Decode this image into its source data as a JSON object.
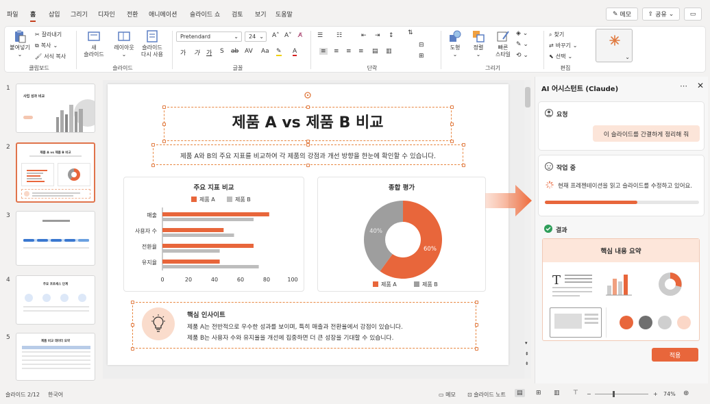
{
  "menu": {
    "items": [
      "파일",
      "홈",
      "삽입",
      "그리기",
      "디자인",
      "전환",
      "애니메이션",
      "슬라이드 쇼",
      "검토",
      "보기",
      "도움말"
    ],
    "active": "홈",
    "memo": "메모",
    "share": "공유"
  },
  "ribbon": {
    "clipboard": {
      "paste": "붙여넣기",
      "cut": "잘라내기",
      "copy": "복사",
      "format_painter": "서식 복사",
      "label": "클립보드"
    },
    "slides": {
      "new": "새\n슬라이드",
      "layout": "레이아웃",
      "reset": "슬라이드\n다시 사용",
      "label": "슬라이드"
    },
    "font": {
      "name": "Pretendard",
      "size": "24",
      "label": "글꼴"
    },
    "paragraph": {
      "label": "단락"
    },
    "drawing": {
      "shapes": "도형",
      "arrange": "정렬",
      "quick_styles": "빠른\n스타일",
      "label": "그리기"
    },
    "editing": {
      "find": "찾기",
      "replace": "바꾸기",
      "select": "선택",
      "label": "편집"
    }
  },
  "thumbnails": [
    {
      "num": "1",
      "title": "사업 성과 비교"
    },
    {
      "num": "2",
      "title": "제품 A vs 제품 B 비교"
    },
    {
      "num": "3",
      "title": ""
    },
    {
      "num": "4",
      "title": "주요 프로세스 단계"
    },
    {
      "num": "5",
      "title": "제품 비교 데이터 요약"
    }
  ],
  "slide": {
    "title": "제품 A vs 제품 B 비교",
    "subtitle": "제품 A와 B의 주요 지표를 비교하여 각 제품의 강점과 개선 방향을 한눈에 확인할 수 있습니다.",
    "bar_title": "주요 지표 비교",
    "donut_title": "종합 평가",
    "insight_title": "핵심 인사이트",
    "insight_line1": "제품 A는 전반적으로 우수한 성과를 보이며, 특히 매출과 전환율에서 강점이 있습니다.",
    "insight_line2": "제품 B는 사용자 수와 유지율을 개선에 집중하면 더 큰 성장을 기대할 수 있습니다."
  },
  "chart_data": [
    {
      "type": "bar",
      "orientation": "horizontal",
      "title": "주요 지표 비교",
      "categories": [
        "매출",
        "사용자 수",
        "전환율",
        "유지율"
      ],
      "series": [
        {
          "name": "제품 A",
          "values": [
            82,
            47,
            70,
            44
          ]
        },
        {
          "name": "제품 B",
          "values": [
            70,
            55,
            44,
            74
          ]
        }
      ],
      "xticks": [
        "0",
        "20",
        "40",
        "60",
        "80",
        "100"
      ],
      "xlim": [
        0,
        100
      ],
      "colors": {
        "제품 A": "#e8663b",
        "제품 B": "#bdbdbd"
      }
    },
    {
      "type": "pie",
      "title": "종합 평가",
      "donut": true,
      "labels": [
        "제품 A",
        "제품 B"
      ],
      "values": [
        60,
        40
      ],
      "value_labels": [
        "60%",
        "40%"
      ],
      "colors": {
        "제품 A": "#e8663b",
        "제품 B": "#9e9e9e"
      }
    }
  ],
  "panel": {
    "title": "AI 어시스턴트 (Claude)",
    "request_label": "요청",
    "request_text": "이 슬라이드를 간결하게 정리해 줘",
    "working_label": "작업 중",
    "working_text": "현재 프레젠테이션을 읽고 슬라이드를 수정하고 있어요.",
    "progress": 0.6,
    "result_label": "결과",
    "result_card_title": "핵심 내용 요약",
    "apply": "적용"
  },
  "status": {
    "slide_pos": "슬라이드 2/12",
    "lang": "한국어",
    "memo": "메모",
    "notes": "슬라이드 노트",
    "zoom": "74%"
  }
}
